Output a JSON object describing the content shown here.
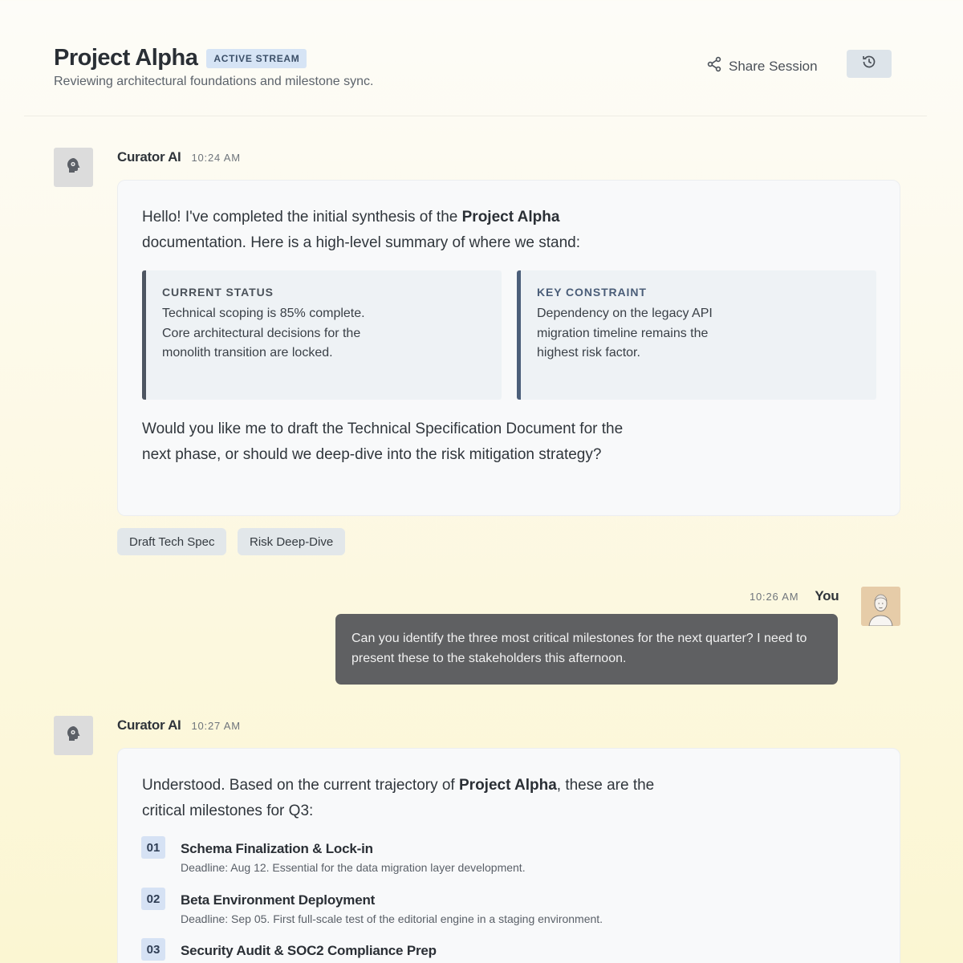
{
  "header": {
    "title": "Project Alpha",
    "badge": "ACTIVE STREAM",
    "subtitle": "Reviewing architectural foundations and milestone sync.",
    "share_label": "Share Session",
    "share_icon": "share-icon",
    "history_icon": "history-icon"
  },
  "messages": [
    {
      "sender": "Curator AI",
      "time": "10:24 AM",
      "intro_before": "Hello! I've completed the initial synthesis of the ",
      "intro_bold": "Project Alpha",
      "intro_after": " documentation. Here is a high-level summary of where we stand:",
      "boxes": [
        {
          "label": "CURRENT STATUS",
          "text": "Technical scoping is 85% complete. Core architectural decisions for the monolith transition are locked."
        },
        {
          "label": "KEY CONSTRAINT",
          "text": "Dependency on the legacy API migration timeline remains the highest risk factor."
        }
      ],
      "outro": "Would you like me to draft the Technical Specification Document for the next phase, or should we deep-dive into the risk mitigation strategy?",
      "chips": [
        "Draft Tech Spec",
        "Risk Deep-Dive"
      ]
    },
    {
      "sender": "You",
      "time": "10:26 AM",
      "text": "Can you identify the three most critical milestones for the next quarter? I need to present these to the stakeholders this afternoon."
    },
    {
      "sender": "Curator AI",
      "time": "10:27 AM",
      "intro_before": "Understood. Based on the current trajectory of ",
      "intro_bold": "Project Alpha",
      "intro_after": ", these are the critical milestones for Q3:",
      "milestones": [
        {
          "num": "01",
          "title": "Schema Finalization & Lock-in",
          "desc": "Deadline: Aug 12. Essential for the data migration layer development."
        },
        {
          "num": "02",
          "title": "Beta Environment Deployment",
          "desc": "Deadline: Sep 05. First full-scale test of the editorial engine in a staging environment."
        },
        {
          "num": "03",
          "title": "Security Audit & SOC2 Compliance Prep",
          "desc": ""
        }
      ]
    }
  ],
  "colors": {
    "badge_bg": "#d6e4f5",
    "user_bubble": "#5f6062",
    "milestone_num_bg": "#d6e2f4",
    "accent_border": "#4c5f7a"
  }
}
